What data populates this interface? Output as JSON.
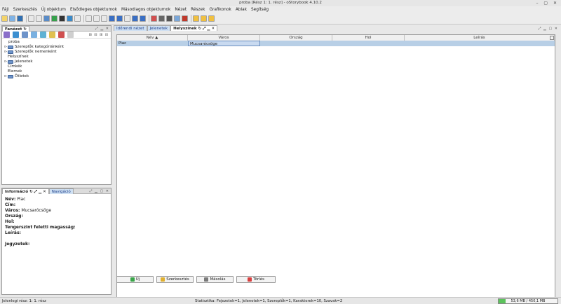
{
  "window": {
    "title": "proba [Rész 1: 1. rész] - oStorybook 4.10.2",
    "controls": "– ▢ ✕"
  },
  "menu": [
    "Fájl",
    "Szerkesztés",
    "Új objektum",
    "Elsődleges objektumok",
    "Másodlagos objektumok",
    "Nézet",
    "Részek",
    "Grafikonok",
    "Ablak",
    "Segítség"
  ],
  "toolbar_colors": [
    "#f3d36a",
    "#7fb3e6",
    "#2f6fb3",
    "#e8e8e8",
    "#e8e8e8",
    "#5a8cc8",
    "#36a14b",
    "#333333",
    "#3a8ac9",
    "#e8e8e8",
    "#e8e8e8",
    "#e8e8e8",
    "#e8e8e8",
    "#3a6fc4",
    "#3a6fc4",
    "#e8e8e8",
    "#3a6fc4",
    "#3a6fc4",
    "#d24f4f",
    "#666666",
    "#555555",
    "#7aa7d9",
    "#c0392b",
    "#f0c040",
    "#f0c040",
    "#f0c040"
  ],
  "left_top": {
    "tab": "Fanézet",
    "tree": [
      {
        "label": "proba",
        "level": 0,
        "folder": false,
        "exp": ""
      },
      {
        "label": "Szereplők kategóriánként",
        "level": 1,
        "folder": true,
        "exp": "⊳"
      },
      {
        "label": "Szereplők nemenként",
        "level": 1,
        "folder": true,
        "exp": "⊳"
      },
      {
        "label": "Helyszínek",
        "level": 1,
        "folder": false,
        "exp": ""
      },
      {
        "label": "Jelenetek",
        "level": 1,
        "folder": true,
        "exp": "⊳"
      },
      {
        "label": "Címkék",
        "level": 1,
        "folder": false,
        "exp": ""
      },
      {
        "label": "Elemek",
        "level": 1,
        "folder": false,
        "exp": ""
      },
      {
        "label": "Ötletek",
        "level": 1,
        "folder": true,
        "exp": "⊳"
      }
    ]
  },
  "left_bottom": {
    "tabs": [
      "Információ",
      "Navigáció"
    ],
    "fields": [
      {
        "label": "Név:",
        "value": " Piac"
      },
      {
        "label": "Cím:",
        "value": ""
      },
      {
        "label": "Város:",
        "value": " Mucsarócsöge"
      },
      {
        "label": "Ország:",
        "value": ""
      },
      {
        "label": "Hol:",
        "value": ""
      },
      {
        "label": "Tengerszint feletti magasság:",
        "value": ""
      },
      {
        "label": "Leírás:",
        "value": ""
      },
      {
        "label": "",
        "value": ""
      },
      {
        "label": "Jegyzetek:",
        "value": ""
      }
    ]
  },
  "main": {
    "tabs": [
      "Időrendi nézet",
      "Jelenetek",
      "Helyszínek"
    ],
    "columns": [
      "Név ▲",
      "Város",
      "Ország",
      "Hol",
      "Leírás"
    ],
    "rows": [
      [
        "Piac",
        "Mucsarócsöge",
        "",
        "",
        ""
      ]
    ],
    "buttons": [
      {
        "label": "Új",
        "color": "#3aa54a"
      },
      {
        "label": "Szerkesztés",
        "color": "#e0b030"
      },
      {
        "label": "Másolás",
        "color": "#7a7a7a"
      },
      {
        "label": "Törlés",
        "color": "#d84040"
      }
    ]
  },
  "status": {
    "left": "Jelenlegi rész: 1: 1. rész",
    "middle": "Statisztika: Fejezetek=1,  Jelenetek=1,  Szereplők=1,  Karakterek=10,  Szavak=2",
    "memory": "53,6 MB / 450,1 MB",
    "memory_fraction": 0.12
  }
}
